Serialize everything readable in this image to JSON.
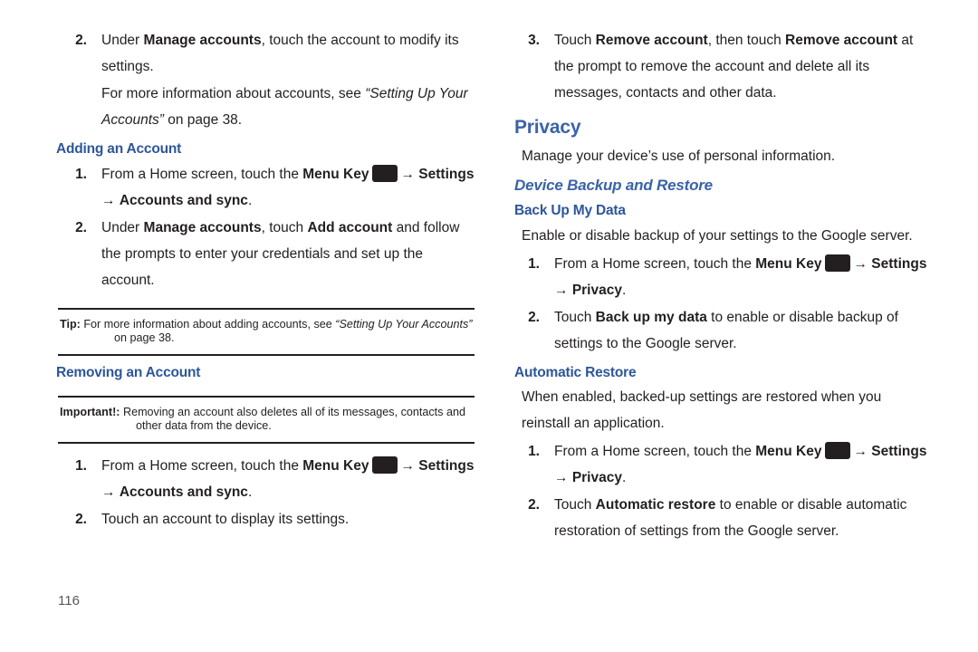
{
  "meta": {
    "page_number": "116",
    "accent_blue": "#3a63a8",
    "heading_blue": "#2d5699",
    "body_color": "#231f20"
  },
  "icons": {
    "menu_key": "menu-key-icon",
    "arrow": "→"
  },
  "left_column": {
    "step_2": {
      "num": "2.",
      "t1": "Under ",
      "b1": "Manage accounts",
      "t2": ", touch the account to modify its settings."
    },
    "cross_ref": {
      "t1": "For more information about accounts, see ",
      "i1": "“Setting Up Your Accounts”",
      "t2": " on page 38."
    },
    "adding_heading": "Adding an Account",
    "adding_step_1": {
      "num": "1.",
      "t1": "From a Home screen, touch the ",
      "b1": "Menu Key",
      "arrow1": "→",
      "b2": "Settings",
      "arrow2": "→",
      "b3": "Accounts and sync",
      "t2": "."
    },
    "adding_step_2": {
      "num": "2.",
      "t1": "Under ",
      "b1": "Manage accounts",
      "t2": ", touch ",
      "b2": "Add account",
      "t3": " and follow the prompts to enter your credentials and set up the account."
    },
    "tip_box": {
      "label": "Tip:",
      "t1": " For more information about adding accounts, see ",
      "i1": "“Setting Up Your Accounts”",
      "t2": " on page 38."
    },
    "removing_heading": "Removing an Account",
    "important_box": {
      "label": "Important!:",
      "t1": " Removing an account also deletes all of its messages, contacts and other data from the device."
    },
    "removing_step_1": {
      "num": "1.",
      "t1": "From a Home screen, touch the ",
      "b1": "Menu Key",
      "arrow1": "→",
      "b2": "Settings",
      "arrow2": "→",
      "b3": "Accounts and sync",
      "t2": "."
    },
    "removing_step_2": {
      "num": "2.",
      "t1": "Touch an account to display its settings."
    }
  },
  "right_column": {
    "step_3": {
      "num": "3.",
      "t1": "Touch ",
      "b1": "Remove account",
      "t2": ", then touch ",
      "b2": "Remove account",
      "t3": " at the prompt to remove the account and delete all its messages, contacts and other data."
    },
    "privacy_heading": "Privacy",
    "privacy_intro": "Manage your device’s use of personal information.",
    "device_backup_heading": "Device Backup and Restore",
    "back_up_heading": "Back Up My Data",
    "back_up_intro": "Enable or disable backup of your settings to the Google server.",
    "back_up_step_1": {
      "num": "1.",
      "t1": "From a Home screen, touch the ",
      "b1": "Menu Key",
      "arrow1": "→",
      "b2": "Settings",
      "arrow2": "→",
      "b3": "Privacy",
      "t2": "."
    },
    "back_up_step_2": {
      "num": "2.",
      "t1": "Touch ",
      "b1": "Back up my data",
      "t2": " to enable or disable backup of settings to the Google server."
    },
    "automatic_restore_heading": "Automatic Restore",
    "automatic_restore_intro": "When enabled, backed-up settings are restored when you reinstall an application.",
    "auto_step_1": {
      "num": "1.",
      "t1": "From a Home screen, touch the ",
      "b1": "Menu Key",
      "arrow1": "→",
      "b2": "Settings",
      "arrow2": "→",
      "b3": "Privacy",
      "t2": "."
    },
    "auto_step_2": {
      "num": "2.",
      "t1": "Touch ",
      "b1": "Automatic restore",
      "t2": " to enable or disable automatic restoration of settings from the Google server."
    }
  }
}
